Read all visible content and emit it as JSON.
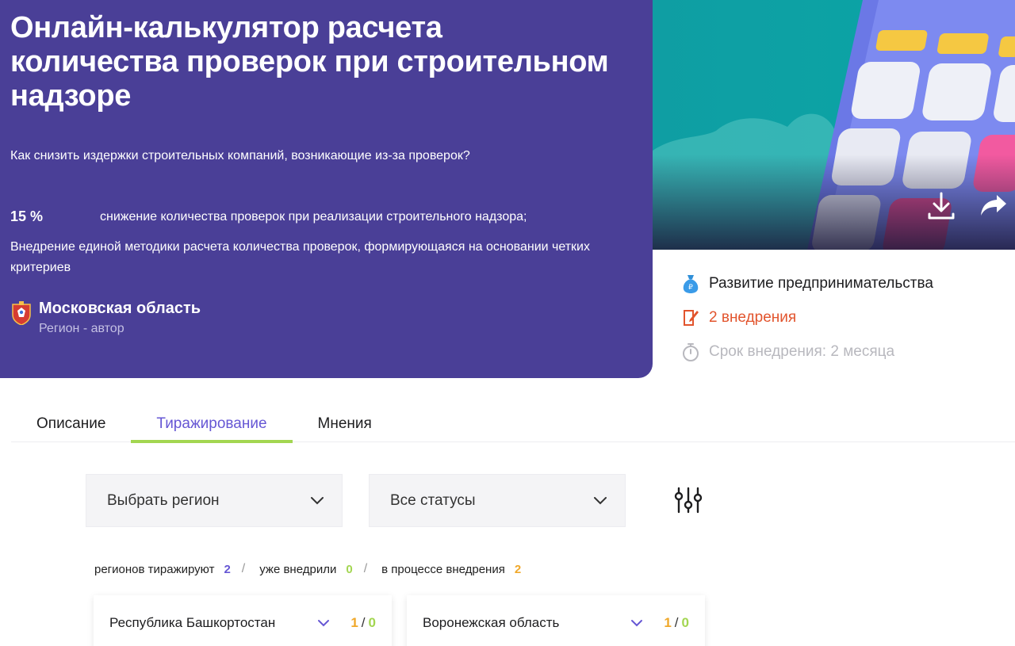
{
  "hero": {
    "title": "Онлайн-калькулятор расчета количества проверок при строительном надзоре",
    "question": "Как снизить издержки строительных компаний, возникающие из-за проверок?",
    "stat_value": "15 %",
    "stat_text": "снижение количества проверок при реализации строительного надзора;",
    "description": "Внедрение единой методики расчета количества проверок, формирующаяся на основании четких критериев",
    "author_name": "Московская область",
    "author_role": "Регион - автор"
  },
  "meta": {
    "category": "Развитие предпринимательства",
    "implementations": "2 внедрения",
    "term": "Срок внедрения: 2 месяца"
  },
  "tabs": [
    {
      "label": "Описание",
      "active": false
    },
    {
      "label": "Тиражирование",
      "active": true
    },
    {
      "label": "Мнения",
      "active": false
    }
  ],
  "filters": {
    "region_select": "Выбрать регион",
    "status_select": "Все статусы"
  },
  "summary": {
    "replicating_label": "регионов тиражируют",
    "replicating_count": "2",
    "implemented_label": "уже внедрили",
    "implemented_count": "0",
    "in_progress_label": "в процессе внедрения",
    "in_progress_count": "2",
    "separator": "/"
  },
  "regions": [
    {
      "name": "Республика Башкортостан",
      "count_a": "1",
      "count_b": "0"
    },
    {
      "name": "Воронежская область",
      "count_a": "1",
      "count_b": "0"
    }
  ],
  "colors": {
    "hero_bg": "#4a3f97",
    "accent_purple": "#6657d4",
    "accent_green": "#a3d651",
    "accent_orange": "#f0a82a",
    "impl_red": "#e2542d"
  }
}
